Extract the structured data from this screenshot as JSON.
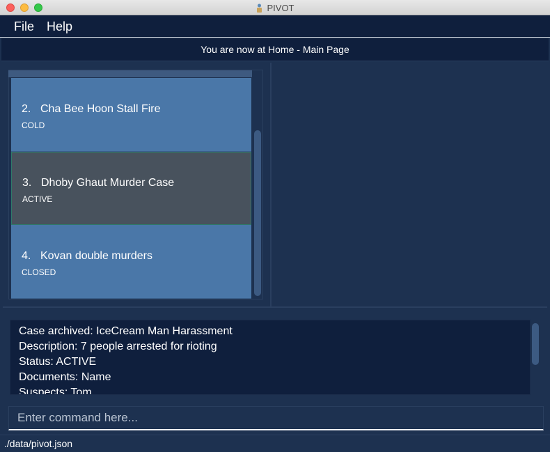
{
  "window": {
    "title": "PIVOT"
  },
  "menu": {
    "items": [
      {
        "label": "File"
      },
      {
        "label": "Help"
      }
    ]
  },
  "header": {
    "location_text": "You are now at Home - Main Page"
  },
  "cases": [
    {
      "index": "2.",
      "title": "Cha Bee Hoon Stall Fire",
      "status": "COLD"
    },
    {
      "index": "3.",
      "title": "Dhoby Ghaut Murder Case",
      "status": "ACTIVE",
      "selected": true
    },
    {
      "index": "4.",
      "title": "Kovan double murders",
      "status": "CLOSED"
    }
  ],
  "result": {
    "lines": [
      "Case archived: IceCream Man Harassment",
      "Description: 7 people arrested for rioting",
      "Status: ACTIVE",
      "Documents: Name",
      "Suspects: Tom"
    ]
  },
  "command": {
    "placeholder": "Enter command here...",
    "value": ""
  },
  "footer": {
    "path": "./data/pivot.json"
  },
  "colors": {
    "background": "#1d3150",
    "menu_bg": "#0f1f3d",
    "card": "#4a77a8",
    "card_selected": "#48525d"
  }
}
